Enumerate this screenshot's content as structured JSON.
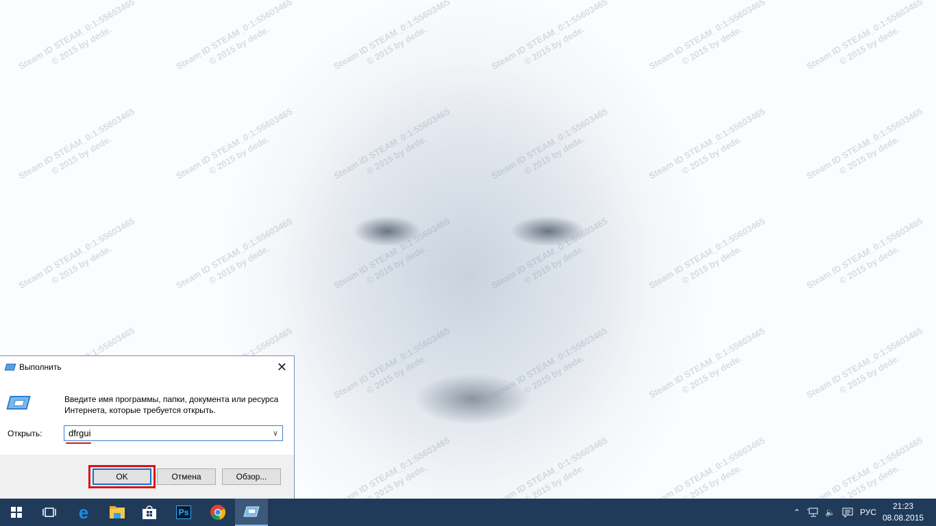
{
  "wallpaper": {
    "watermark_line1": "Steam ID  STEAM_0:1:55603465",
    "watermark_line2": "© 2015 by dede."
  },
  "dialog": {
    "title": "Выполнить",
    "close_glyph": "✕",
    "description_line1": "Введите имя программы, папки, документа или ресурса",
    "description_line2": "Интернета, которые требуется открыть.",
    "open_label": "Открыть:",
    "input_value": "dfrgui",
    "ok_label": "OK",
    "cancel_label": "Отмена",
    "browse_label": "Обзор..."
  },
  "taskbar": {
    "items": [
      "start",
      "task-view",
      "edge",
      "file-explorer",
      "store",
      "photoshop",
      "chrome",
      "run"
    ],
    "ps_label": "Ps",
    "language": "РУС",
    "time": "21:23",
    "date": "08.08.2015"
  },
  "colors": {
    "taskbar": "#203a5a",
    "highlight": "#e01010",
    "accent": "#0f6fd0"
  }
}
